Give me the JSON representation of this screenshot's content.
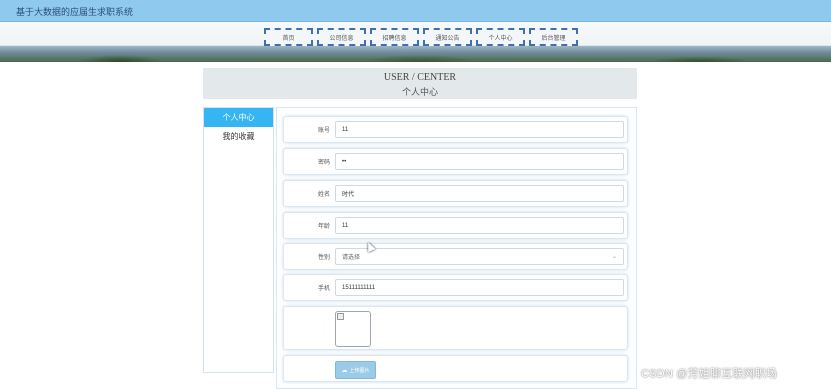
{
  "app": {
    "title": "基于大数据的应届生求职系统"
  },
  "nav": {
    "items": [
      "首页",
      "公司信息",
      "招聘信息",
      "通知公告",
      "个人中心",
      "后台管理"
    ]
  },
  "header": {
    "en": "USER / CENTER",
    "cn": "个人中心"
  },
  "sidebar": {
    "items": [
      "个人中心",
      "我的收藏"
    ],
    "active": 0
  },
  "form": {
    "fields": [
      {
        "label": "账号",
        "value": "11",
        "type": "text"
      },
      {
        "label": "密码",
        "value": "••",
        "type": "password"
      },
      {
        "label": "姓名",
        "value": "时代",
        "type": "text"
      },
      {
        "label": "年龄",
        "value": "11",
        "type": "text"
      },
      {
        "label": "性别",
        "value": "请选择",
        "type": "select"
      },
      {
        "label": "手机",
        "value": "15111111111",
        "type": "text"
      }
    ],
    "upload_label": "上传图片"
  },
  "watermark": "CSDN @芳姐聊互联网职场",
  "colors": {
    "topbar": "#8fc9ee",
    "accent": "#35b6f2",
    "nav_border": "#3f6fae"
  }
}
